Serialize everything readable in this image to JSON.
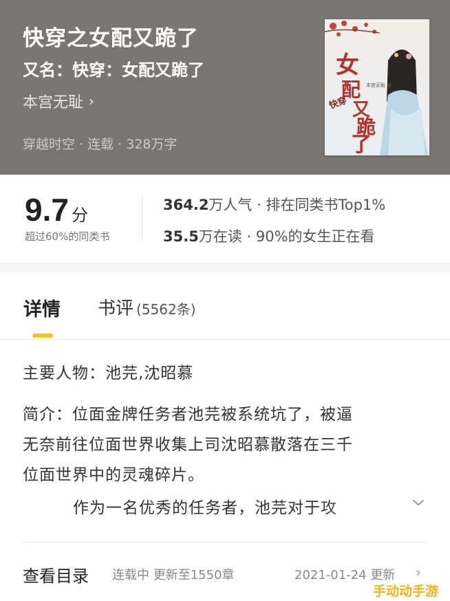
{
  "book": {
    "title": "快穿之女配又跪了",
    "alias": "又名：快穿：女配又跪了",
    "author": "本宫无耻",
    "author_chevron": "›",
    "meta": "穿越时空 · 连载 · 328万字",
    "cover": {
      "title_text": "女配又跪了",
      "series_text": "快穿",
      "author_text": "本宫无耻 著",
      "accent_color": "#c0392b"
    }
  },
  "stats": {
    "score": "9.7",
    "score_unit": "分",
    "score_sub": "超过60%的同类书",
    "popularity_value": "364.2",
    "popularity_rest": "万人气 · 排在同类书Top1%",
    "readers_value": "35.5",
    "readers_rest": "万在读 · 90%的女生正在看"
  },
  "tabs": {
    "detail": "详情",
    "review": "书评",
    "review_count": "(5562条)",
    "active_color": "#f6c21c"
  },
  "details": {
    "characters": "主要人物：池芫,沈昭慕",
    "intro_lines": [
      "简介：位面金牌任务者池芫被系统坑了，被逼",
      "无奈前往位面世界收集上司沈昭慕散落在三千",
      "位面世界中的灵魂碎片。"
    ],
    "intro_more": "作为一名优秀的任务者，池芫对于攻",
    "expand_icon": "chevron-down-icon"
  },
  "catalog": {
    "title": "查看目录",
    "status": "连载中 更新至1550章",
    "updated": "2021-01-24 更新",
    "chevron": "›"
  },
  "watermark": "手动动手游"
}
